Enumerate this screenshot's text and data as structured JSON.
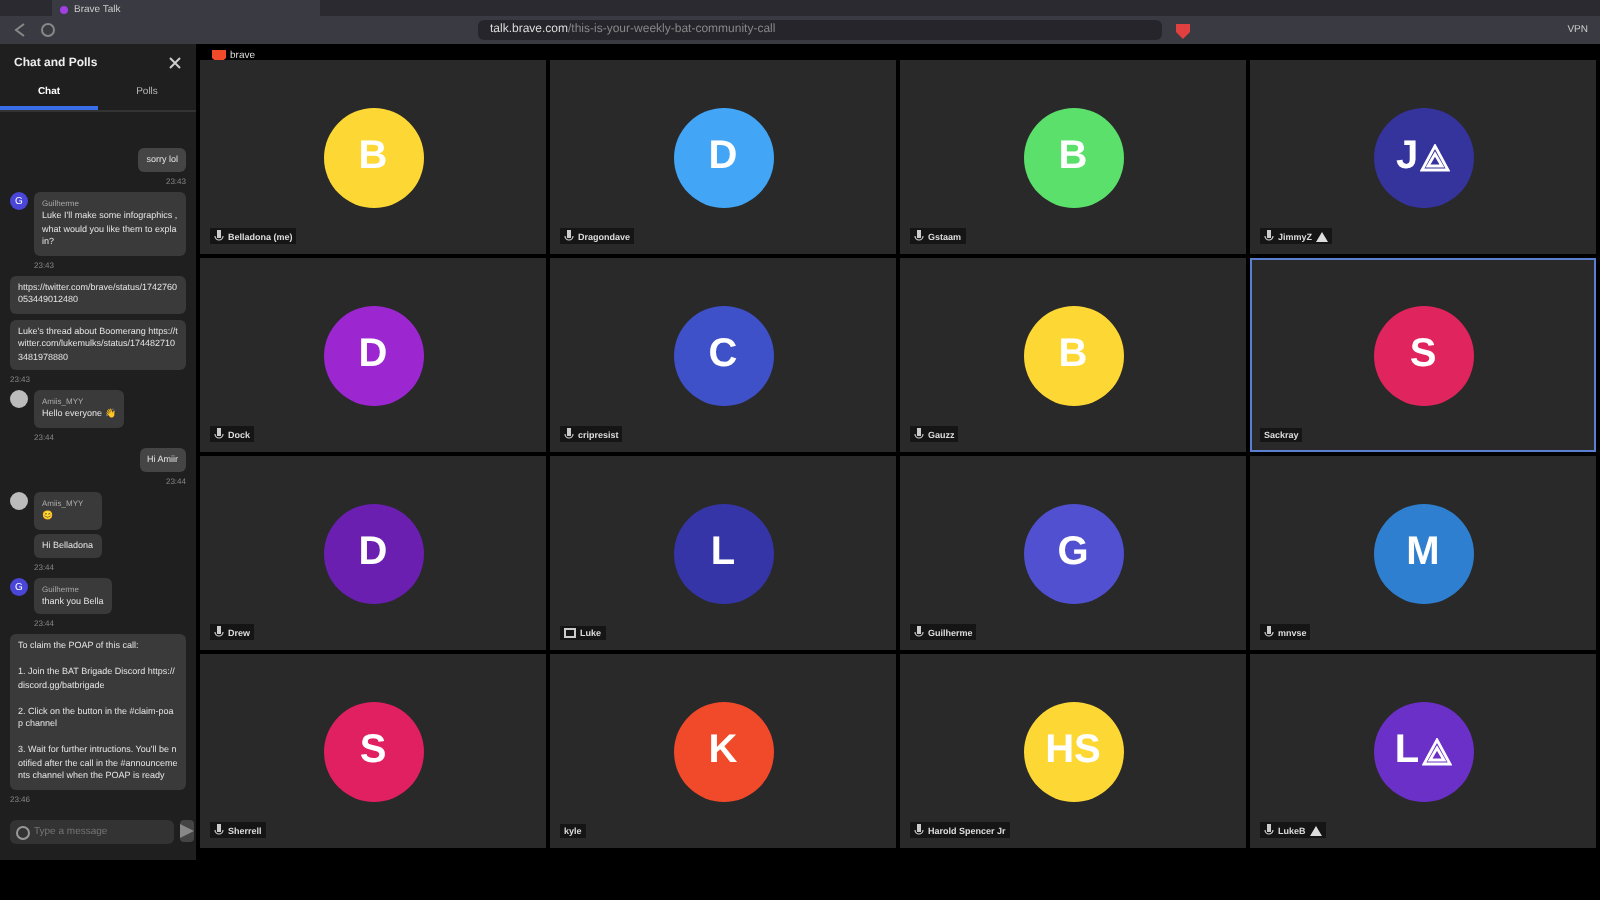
{
  "browser": {
    "tab_title": "Brave Talk",
    "url_host": "talk.brave.com",
    "url_path": "/this-is-your-weekly-bat-community-call",
    "vpn_label": "VPN"
  },
  "sidebar": {
    "title": "Chat and Polls",
    "tabs": [
      {
        "label": "Chat",
        "selected": true
      },
      {
        "label": "Polls",
        "selected": false
      }
    ],
    "messages": [
      {
        "own": true,
        "texts": [
          "sorry lol"
        ],
        "time": "23:43"
      },
      {
        "own": false,
        "initial": "G",
        "author": "Guilherme",
        "texts": [
          "Luke I'll make some infographics , what would you like them to explain?"
        ],
        "time": "23:43"
      },
      {
        "own": false,
        "texts": [
          "https://twitter.com/brave/status/1742760053449012480"
        ]
      },
      {
        "own": false,
        "texts": [
          "Luke's thread about Boomerang https://twitter.com/lukemulks/status/1744827103481978880"
        ],
        "time": "23:43"
      },
      {
        "own": false,
        "author": "Amiis_MYY",
        "texts": [
          "Hello everyone 👋"
        ],
        "time": "23:44"
      },
      {
        "own": true,
        "texts": [
          "Hi Amiir"
        ],
        "time": "23:44"
      },
      {
        "own": false,
        "author": "Amiis_MYY",
        "texts": [
          "😊",
          "Hi Belladona"
        ],
        "time": "23:44"
      },
      {
        "own": false,
        "initial": "G",
        "author": "Guilherme",
        "texts": [
          "thank you Bella"
        ],
        "time": "23:44"
      },
      {
        "own": false,
        "texts": [
          "To claim the POAP of this call:\n\n1. Join the BAT Brigade Discord https://discord.gg/batbrigade\n\n2. Click on the button in the #claim-poap channel\n\n3. Wait for further intructions. You'll be notified after the call in the #announcements channel when the POAP is ready"
        ],
        "time": "23:46"
      }
    ],
    "input": {
      "placeholder": "Type a message"
    }
  },
  "logo_text": "brave",
  "tiles": [
    {
      "name": "Belladona (me)",
      "initials": "B",
      "color": "#fdd835",
      "kind": "mic",
      "logo": false,
      "selected": false
    },
    {
      "name": "Dragondave",
      "initials": "D",
      "color": "#42a5f5",
      "kind": "mic",
      "logo": false,
      "selected": false
    },
    {
      "name": "Gstaam",
      "initials": "B",
      "color": "#5ce06c",
      "kind": "mic",
      "logo": false,
      "selected": false
    },
    {
      "name": "JimmyZ",
      "initials": "J",
      "color": "#35339c",
      "kind": "mic",
      "logo": true,
      "selected": false
    },
    {
      "name": "Dock",
      "initials": "D",
      "color": "#9c27d0",
      "kind": "mic",
      "logo": false,
      "selected": false
    },
    {
      "name": "cripresist",
      "initials": "C",
      "color": "#3f51c8",
      "kind": "mic",
      "logo": false,
      "selected": false
    },
    {
      "name": "Gauzz",
      "initials": "B",
      "color": "#fdd835",
      "kind": "mic",
      "logo": false,
      "selected": false
    },
    {
      "name": "Sackray",
      "initials": "S",
      "color": "#e0245e",
      "kind": "none",
      "logo": false,
      "selected": true
    },
    {
      "name": "Drew",
      "initials": "D",
      "color": "#6a1fb0",
      "kind": "mic",
      "logo": false,
      "selected": false
    },
    {
      "name": "Luke",
      "initials": "L",
      "color": "#3535a8",
      "kind": "screen",
      "logo": false,
      "selected": false
    },
    {
      "name": "Guilherme",
      "initials": "G",
      "color": "#5050d0",
      "kind": "mic",
      "logo": false,
      "selected": false
    },
    {
      "name": "mnvse",
      "initials": "M",
      "color": "#2f7fd0",
      "kind": "mic",
      "logo": false,
      "selected": false
    },
    {
      "name": "Sherrell",
      "initials": "S",
      "color": "#e02060",
      "kind": "mic",
      "logo": false,
      "selected": false
    },
    {
      "name": "kyle",
      "initials": "K",
      "color": "#f04a2a",
      "kind": "none",
      "logo": false,
      "selected": false
    },
    {
      "name": "Harold Spencer Jr",
      "initials": "HS",
      "color": "#fdd835",
      "kind": "mic",
      "logo": false,
      "selected": false
    },
    {
      "name": "LukeB",
      "initials": "L",
      "color": "#6a30c8",
      "kind": "mic",
      "logo": true,
      "selected": false
    }
  ]
}
